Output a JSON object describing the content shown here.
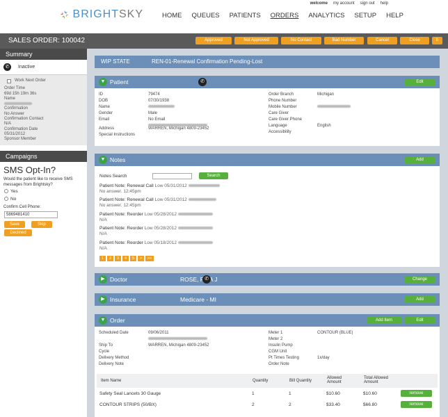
{
  "brand": {
    "name_a": "BRIGHT",
    "name_b": "SKY"
  },
  "util_links": [
    "welcome",
    "my account",
    "sign out",
    "help"
  ],
  "nav": [
    "HOME",
    "QUEUES",
    "PATIENTS",
    "ORDERS",
    "ANALYTICS",
    "SETUP",
    "HELP"
  ],
  "order_bar": {
    "title": "SALES ORDER: 100042",
    "buttons": [
      "Approved",
      "Not Approved",
      "No Contact",
      "Bad Number",
      "Cancel",
      "Close",
      "b"
    ]
  },
  "sidebar": {
    "summary_head": "Summary",
    "status": "Inactive",
    "work_next": "Work Next Order",
    "order_time_label": "Order Time",
    "order_time": "69d 15h 19m 36s",
    "name_label": "Name",
    "confirmation_label": "Confirmation",
    "confirmation": "No Answer",
    "confirmation_contact_label": "Confirmation Contact",
    "confirmation_contact": "N/A",
    "confirmation_date_label": "Confirmation Date",
    "confirmation_date": "05/31/2012",
    "sponsor_label": "Sponsor Member",
    "campaigns_head": "Campaigns",
    "sms_title": "SMS Opt-In?",
    "sms_question": "Would the patient like to receive SMS messages from Brightsky?",
    "yes": "Yes",
    "no": "No",
    "confirm_phone_label": "Confirm Cell Phone:",
    "phone_value": "5869481410",
    "save": "Save",
    "skip": "Skip",
    "declined": "Declined"
  },
  "wip": {
    "label": "WIP STATE",
    "value": "REN-01-Renewal Confirmation Pending-Lost"
  },
  "patient": {
    "title": "Patient",
    "edit": "Edit",
    "left_labels": [
      "ID",
      "DOB",
      "Name",
      "Gender",
      "Email",
      "",
      "Address",
      "Special Instructions"
    ],
    "left_values": [
      "79474",
      "07/30/1938",
      "",
      "Male",
      "No Email",
      "",
      "WARREN, Michigan 4809-23452",
      ""
    ],
    "right_labels": [
      "Order Branch",
      "Phone Number",
      "Mobile Number",
      "Care Giver",
      "Care Giver Phone",
      "Language",
      "Accessibility"
    ],
    "right_values": [
      "Michigan",
      "",
      "",
      "",
      "",
      "English",
      ""
    ]
  },
  "notes": {
    "title": "Notes",
    "add": "Add",
    "search_label": "Notes Search",
    "search_btn": "Search",
    "items": [
      {
        "head": "Patient Note: Renewal Call",
        "meta": "Low 05/31/2012",
        "sub": "No answer. 12:45pm"
      },
      {
        "head": "Patient Note: Renewal Call",
        "meta": "Low 05/31/2012",
        "sub": "No answer. 12:45pm"
      },
      {
        "head": "Patient Note: Reorder",
        "meta": "Low 05/28/2012",
        "sub": "N/A"
      },
      {
        "head": "Patient Note: Reorder",
        "meta": "Low 05/28/2012",
        "sub": "N/A"
      },
      {
        "head": "Patient Note: Reorder",
        "meta": "Low 05/18/2012",
        "sub": "N/A"
      }
    ],
    "pages": [
      "1",
      "2",
      "3",
      "4",
      "5",
      ">",
      ">>"
    ]
  },
  "doctor": {
    "title": "Doctor",
    "name": "ROSE, RITA J",
    "change": "Change"
  },
  "insurance": {
    "title": "Insurance",
    "name": "Medicare - MI",
    "add": "Add"
  },
  "order": {
    "title": "Order",
    "add_item": "Add Item",
    "edit": "Edit",
    "left_labels": [
      "Scheduled Date",
      "",
      "Ship To",
      "Cycle",
      "Delivery Method",
      "Delivery Note"
    ],
    "left_values": [
      "09/06/2011",
      "",
      "WARREN, Michigan 4809-23452",
      "",
      "",
      ""
    ],
    "right_labels": [
      "Meter 1",
      "Meter 2",
      "Insulin Pump",
      "CGM Unit",
      "Pt Times Testing",
      "Order Note"
    ],
    "right_values": [
      "CONTOUR (BLUE)",
      "",
      "",
      "",
      "1x/day",
      ""
    ],
    "columns": [
      "Item Name",
      "Quantity",
      "Bill Quantity",
      "Allowed Amount",
      "Total Allowed Amount"
    ],
    "items": [
      {
        "name": "Safety Seal Lancets 30 Gauge",
        "qty": "1",
        "bill_qty": "1",
        "allowed": "$10.60",
        "total": "$10.60",
        "action": "remove"
      },
      {
        "name": "CONTOUR STRIPS (50/BX)",
        "qty": "2",
        "bill_qty": "2",
        "allowed": "$33.40",
        "total": "$66.80",
        "action": "remove"
      }
    ]
  },
  "colors": {
    "accent_orange": "#f0a020",
    "green": "#58b03c",
    "panel_blue": "#6b8fb8",
    "dark_bar": "#5a5a5a"
  }
}
